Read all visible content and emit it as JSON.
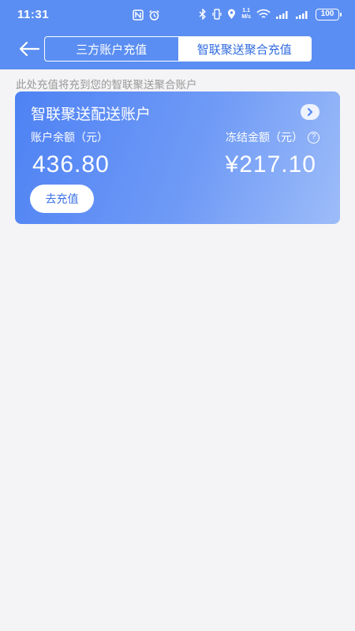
{
  "status_bar": {
    "time": "11:31",
    "net_speed_value": "1.1",
    "net_speed_unit": "M/s",
    "battery": "100"
  },
  "nav": {
    "tabs": [
      {
        "label": "三方账户充值",
        "active": false
      },
      {
        "label": "智联聚送聚合充值",
        "active": true
      }
    ]
  },
  "notice": "此处充值将充到您的智联聚送聚合账户",
  "card": {
    "title": "智联聚送配送账户",
    "balance_label": "账户余额（元）",
    "frozen_label": "冻结金额（元）",
    "balance_value": "436.80",
    "frozen_value": "¥217.10",
    "recharge_button": "去充值"
  },
  "colors": {
    "header": "#5b8ef2",
    "card_start": "#4e82f4",
    "card_end": "#9dbcf8",
    "active_tab_text": "#2f6be0",
    "background": "#f4f4f6"
  }
}
